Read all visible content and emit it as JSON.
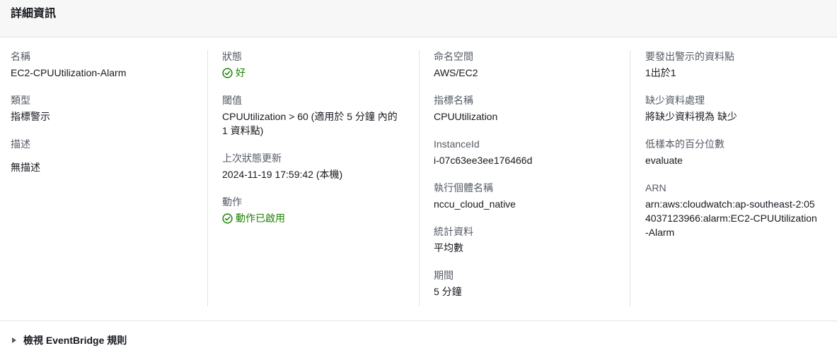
{
  "panel": {
    "title": "詳細資訊"
  },
  "col1": {
    "name_label": "名稱",
    "name_value": "EC2-CPUUtilization-Alarm",
    "type_label": "類型",
    "type_value": "指標警示",
    "desc_label": "描述",
    "desc_value": "無描述"
  },
  "col2": {
    "state_label": "狀態",
    "state_value": "好",
    "threshold_label": "閾值",
    "threshold_value": "CPUUtilization > 60 (適用於 5 分鐘 內的 1 資料點)",
    "last_update_label": "上次狀態更新",
    "last_update_value": "2024-11-19 17:59:42 (本機)",
    "actions_label": "動作",
    "actions_value": "動作已啟用"
  },
  "col3": {
    "namespace_label": "命名空間",
    "namespace_value": "AWS/EC2",
    "metric_label": "指標名稱",
    "metric_value": "CPUUtilization",
    "instance_label": "InstanceId",
    "instance_value": "i-07c63ee3ee176466d",
    "instance_name_label": "執行個體名稱",
    "instance_name_value": "nccu_cloud_native",
    "stat_label": "統計資料",
    "stat_value": "平均數",
    "period_label": "期間",
    "period_value": "5 分鐘"
  },
  "col4": {
    "datapoints_label": "要發出警示的資料點",
    "datapoints_value": "1出於1",
    "missing_label": "缺少資料處理",
    "missing_value": "將缺少資料視為 缺少",
    "percentile_label": "低樣本的百分位數",
    "percentile_value": "evaluate",
    "arn_label": "ARN",
    "arn_value": "arn:aws:cloudwatch:ap-southeast-2:054037123966:alarm:EC2-CPUUtilization-Alarm"
  },
  "footer": {
    "expander_label": "檢視 EventBridge 規則"
  },
  "icons": {
    "ok_status": "check-circle-icon",
    "expander": "caret-right-icon"
  },
  "colors": {
    "success": "#1d8102",
    "header_bg": "#f7f7f7",
    "label": "#545b64",
    "text": "#16191f"
  }
}
